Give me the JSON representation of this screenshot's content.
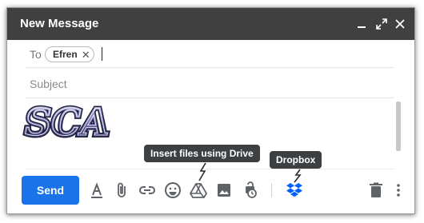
{
  "window": {
    "title": "New Message"
  },
  "recipients": {
    "to_label": "To",
    "chips": [
      {
        "name": "Efren",
        "remove": "✕"
      }
    ]
  },
  "subject": {
    "placeholder": "Subject"
  },
  "body": {
    "signature_logo_text": "SCA"
  },
  "toolbar": {
    "send_label": "Send",
    "icons": [
      "format-text-icon",
      "attach-file-icon",
      "insert-link-icon",
      "insert-emoji-icon",
      "google-drive-icon",
      "insert-photo-icon",
      "confidential-mode-icon",
      "dropbox-icon",
      "discard-draft-icon",
      "more-options-icon"
    ]
  },
  "tooltips": {
    "drive": "Insert files using Drive",
    "dropbox": "Dropbox"
  },
  "colors": {
    "titlebar": "#404040",
    "send": "#1a73e8",
    "dropbox": "#0061fe",
    "icon": "#5f6368"
  }
}
